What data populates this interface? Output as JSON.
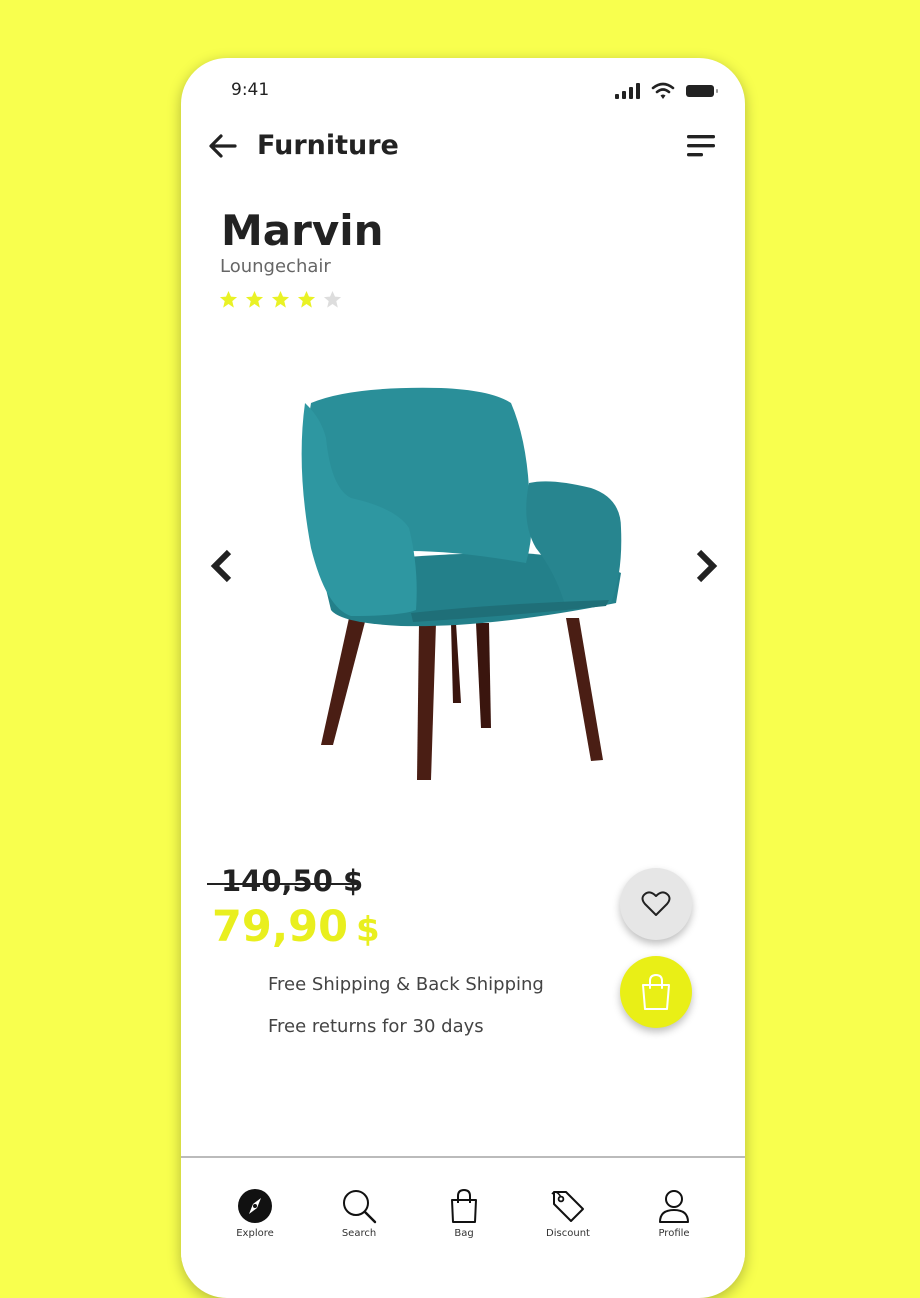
{
  "status": {
    "time": "9:41"
  },
  "header": {
    "title": "Furniture"
  },
  "product": {
    "name": "Marvin",
    "category": "Loungechair",
    "rating": 4,
    "rating_max": 5,
    "old_price": "140,50 $",
    "price": "79,90",
    "currency": "$",
    "features": [
      "Free Shipping & Back Shipping",
      "Free returns for 30 days"
    ]
  },
  "tabs": [
    {
      "label": "Explore",
      "icon": "compass-icon",
      "active": true
    },
    {
      "label": "Search",
      "icon": "search-icon"
    },
    {
      "label": "Bag",
      "icon": "bag-icon"
    },
    {
      "label": "Discount",
      "icon": "tag-icon"
    },
    {
      "label": "Profile",
      "icon": "user-icon"
    }
  ],
  "colors": {
    "background": "#f8ff4e",
    "accent": "#e9ef16",
    "chair_fabric": "#2a8f99",
    "chair_legs": "#4a1e14",
    "star_active": "#e9f225",
    "star_inactive": "#dddddd"
  }
}
